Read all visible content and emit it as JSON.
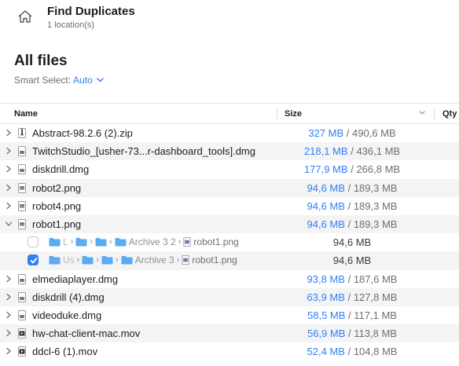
{
  "header": {
    "title": "Find Duplicates",
    "subtitle": "1 location(s)"
  },
  "section": {
    "title": "All files",
    "smart_select_label": "Smart Select:",
    "smart_select_value": "Auto"
  },
  "columns": {
    "name": "Name",
    "size": "Size",
    "qty": "Qty"
  },
  "colors": {
    "accent": "#2f7ff5",
    "folder": "#5aaaf5",
    "row_alt": "#f4f4f5"
  },
  "files": [
    {
      "name": "Abstract-98.2.6 (2).zip",
      "selected_size": "327 MB",
      "total_size": "490,6 MB",
      "icon": "zip-file-icon"
    },
    {
      "name": "TwitchStudio_[usher-73...r-dashboard_tools].dmg",
      "selected_size": "218,1 MB",
      "total_size": "436,1 MB",
      "icon": "disk-image-icon"
    },
    {
      "name": "diskdrill.dmg",
      "selected_size": "177,9 MB",
      "total_size": "266,8 MB",
      "icon": "disk-image-icon"
    },
    {
      "name": "robot2.png",
      "selected_size": "94,6 MB",
      "total_size": "189,3 MB",
      "icon": "image-file-icon"
    },
    {
      "name": "robot4.png",
      "selected_size": "94,6 MB",
      "total_size": "189,3 MB",
      "icon": "image-file-icon"
    },
    {
      "name": "robot1.png",
      "selected_size": "94,6 MB",
      "total_size": "189,3 MB",
      "icon": "image-file-icon"
    }
  ],
  "robot1_copies": [
    {
      "checked": false,
      "root": "L",
      "folder": "Archive 3 2",
      "filename": "robot1.png",
      "size": "94,6 MB"
    },
    {
      "checked": true,
      "root": "Us",
      "folder": "Archive 3",
      "filename": "robot1.png",
      "size": "94,6 MB"
    }
  ],
  "files_after": [
    {
      "name": "elmediaplayer.dmg",
      "selected_size": "93,8 MB",
      "total_size": "187,6 MB",
      "icon": "disk-image-icon"
    },
    {
      "name": "diskdrill (4).dmg",
      "selected_size": "63,9 MB",
      "total_size": "127,8 MB",
      "icon": "disk-image-icon"
    },
    {
      "name": "videoduke.dmg",
      "selected_size": "58,5 MB",
      "total_size": "117,1 MB",
      "icon": "disk-image-icon"
    },
    {
      "name": "hw-chat-client-mac.mov",
      "selected_size": "56,9 MB",
      "total_size": "113,8 MB",
      "icon": "video-file-icon"
    },
    {
      "name": "ddcl-6 (1).mov",
      "selected_size": "52,4 MB",
      "total_size": "104,8 MB",
      "icon": "video-file-icon"
    }
  ],
  "separator": "/"
}
